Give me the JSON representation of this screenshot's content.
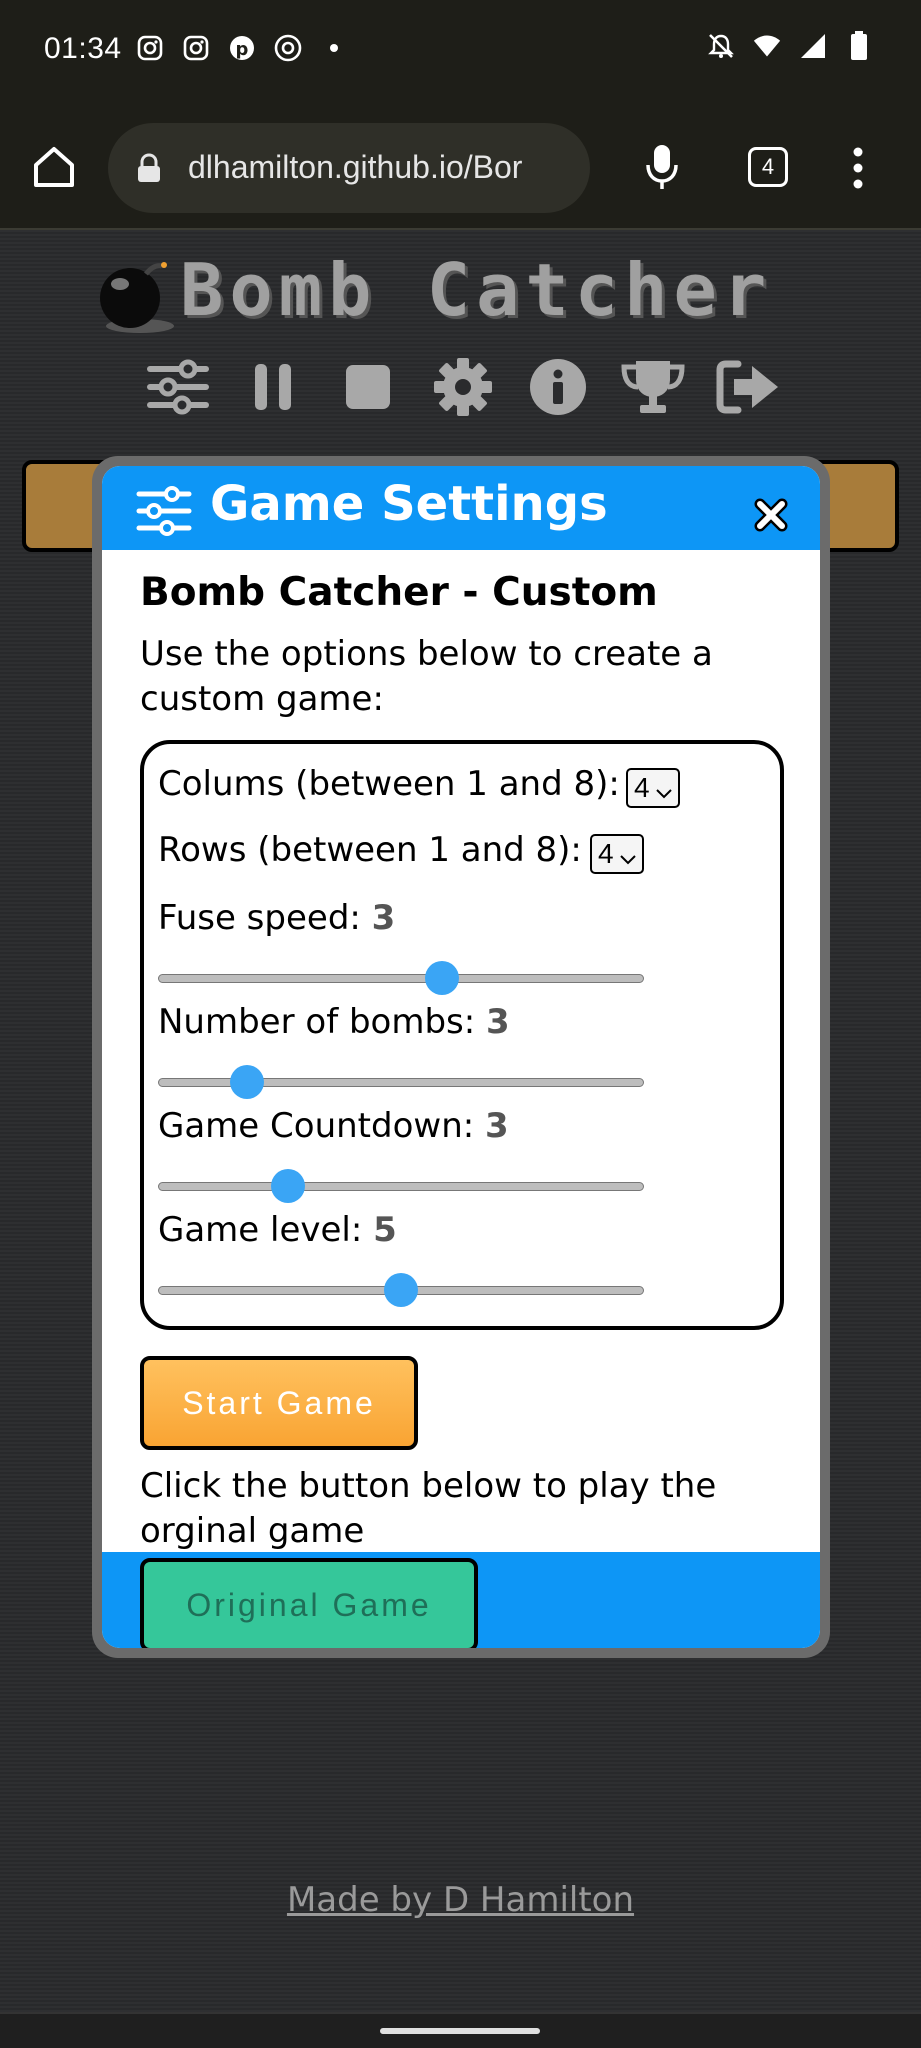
{
  "status_bar": {
    "time": "01:34",
    "left_icons": [
      "instagram-icon",
      "instagram-icon",
      "pinterest-icon",
      "threads-icon",
      "dot-icon"
    ],
    "right_icons": [
      "notifications-off-icon",
      "wifi-icon",
      "signal-icon",
      "battery-icon"
    ]
  },
  "browser": {
    "url": "dlhamilton.github.io/Bor",
    "tab_count": "4"
  },
  "game": {
    "title": "Bomb Catcher",
    "toolbar_icons": [
      "sliders-icon",
      "pause-icon",
      "stop-icon",
      "gear-icon",
      "info-icon",
      "trophy-icon",
      "exit-icon"
    ]
  },
  "modal": {
    "title": "Game Settings",
    "subtitle": "Bomb Catcher - Custom",
    "intro": "Use the options below to create a custom game:",
    "columns_label": "Colums (between 1 and 8):",
    "columns_value": "4",
    "rows_label": "Rows (between 1 and 8):",
    "rows_value": "4",
    "fuse_label": "Fuse speed:",
    "fuse_value": "3",
    "fuse_level": 0.59,
    "bombs_label": "Number of bombs:",
    "bombs_value": "3",
    "bombs_level": 0.16,
    "countdown_label": "Game Countdown:",
    "countdown_value": "3",
    "countdown_level": 0.25,
    "level_label": "Game level:",
    "level_value": "5",
    "level_level": 0.5,
    "start_button": "Start Game",
    "play_text": "Click the button below to play the orginal game",
    "original_button": "Original Game"
  },
  "footer": {
    "credit": "Made by D Hamilton"
  },
  "colors": {
    "modal_header": "#0d96f6",
    "start_button": "#f9a433",
    "original_button": "#35c79a",
    "slider_thumb": "#3aa5f5"
  }
}
